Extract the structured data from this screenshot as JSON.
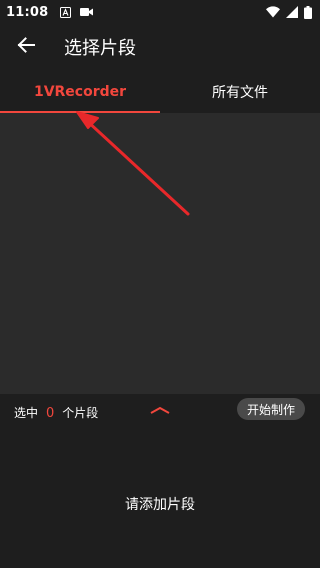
{
  "status_bar": {
    "time": "11:08",
    "left_icons": [
      "a-notification-icon",
      "video-camera-icon"
    ],
    "right_icons": [
      "wifi-icon",
      "signal-icon",
      "battery-icon"
    ]
  },
  "app_bar": {
    "back_icon": "arrow-left-icon",
    "title": "选择片段"
  },
  "tabs": [
    {
      "label": "1VRecorder",
      "active": true
    },
    {
      "label": "所有文件",
      "active": false
    }
  ],
  "selection": {
    "prefix": "选中",
    "count": "0",
    "suffix": "个片段",
    "expand_icon": "chevron-up-icon",
    "start_button_label": "开始制作"
  },
  "empty_hint": "请添加片段",
  "colors": {
    "accent": "#f2473d",
    "background": "#1e1e1e",
    "content_background": "#2b2b2b",
    "button_background": "#4a4a4a",
    "annotation_arrow": "#e8282a"
  }
}
